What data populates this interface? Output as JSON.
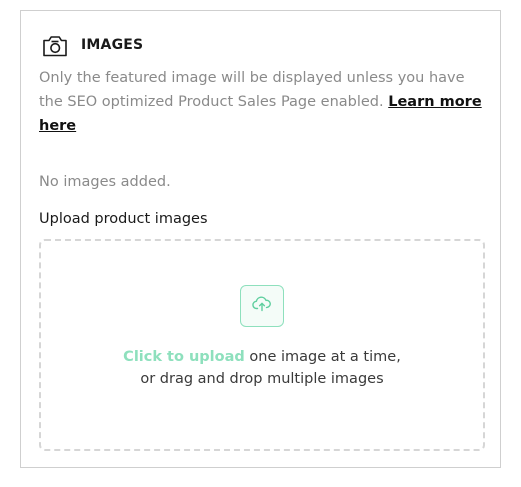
{
  "section": {
    "title": "IMAGES",
    "icon": "camera-icon",
    "description": "Only the featured image will be displayed unless you have the SEO optimized Product Sales Page enabled.",
    "learn_more_label": "Learn more here"
  },
  "images": {
    "empty_text": "No images added.",
    "upload_label": "Upload product images"
  },
  "dropzone": {
    "icon": "cloud-upload-icon",
    "click_label": "Click to upload",
    "line1_rest": " one image at a time,",
    "line2": "or drag and drop multiple images",
    "accent_color": "#8ee0bd"
  }
}
